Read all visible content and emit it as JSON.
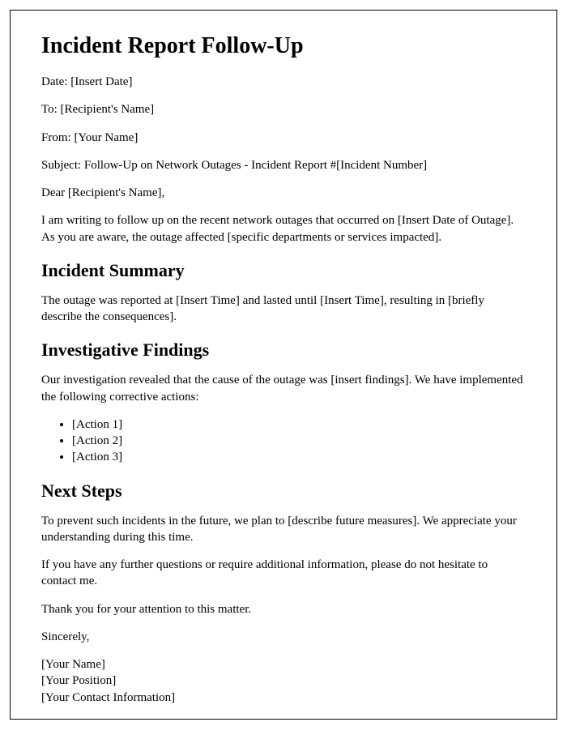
{
  "title": "Incident Report Follow-Up",
  "meta": {
    "date_label": "Date: ",
    "date_value": "[Insert Date]",
    "to_label": "To: ",
    "to_value": "[Recipient's Name]",
    "from_label": "From: ",
    "from_value": "[Your Name]",
    "subject_label": "Subject: ",
    "subject_value": "Follow-Up on Network Outages - Incident Report #[Incident Number]"
  },
  "salutation": "Dear [Recipient's Name],",
  "intro": "I am writing to follow up on the recent network outages that occurred on [Insert Date of Outage]. As you are aware, the outage affected [specific departments or services impacted].",
  "sections": {
    "summary": {
      "heading": "Incident Summary",
      "body": "The outage was reported at [Insert Time] and lasted until [Insert Time], resulting in [briefly describe the consequences]."
    },
    "findings": {
      "heading": "Investigative Findings",
      "body": "Our investigation revealed that the cause of the outage was [insert findings]. We have implemented the following corrective actions:",
      "actions": [
        "[Action 1]",
        "[Action 2]",
        "[Action 3]"
      ]
    },
    "next": {
      "heading": "Next Steps",
      "body1": "To prevent such incidents in the future, we plan to [describe future measures]. We appreciate your understanding during this time.",
      "body2": "If you have any further questions or require additional information, please do not hesitate to contact me.",
      "body3": "Thank you for your attention to this matter."
    }
  },
  "closing": "Sincerely,",
  "signature": {
    "name": "[Your Name]",
    "position": "[Your Position]",
    "contact": "[Your Contact Information]"
  }
}
